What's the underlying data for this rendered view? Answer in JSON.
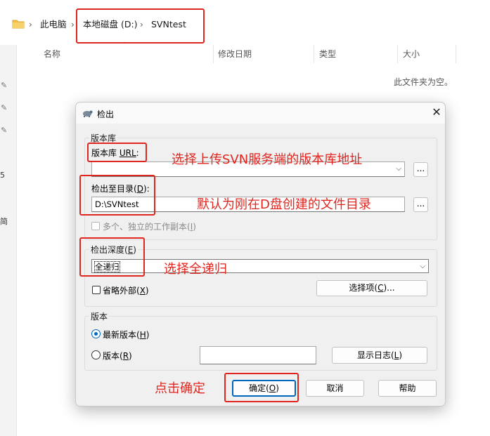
{
  "explorer": {
    "breadcrumb": [
      "此电脑",
      "本地磁盘 (D:)",
      "SVNtest"
    ],
    "columns": [
      "名称",
      "修改日期",
      "类型",
      "大小"
    ],
    "empty_message": "此文件夹为空。",
    "pane_fragments": [
      "5",
      "简"
    ]
  },
  "dialog": {
    "title": "检出",
    "close": "✕",
    "repo_group": "版本库",
    "url_label_prefix": "版本库 ",
    "url_label_key": "URL",
    "url_label_suffix": ":",
    "url_value": "",
    "browse": "...",
    "checkout_dir_prefix": "检出至目录(",
    "checkout_dir_key": "D",
    "checkout_dir_suffix": "):",
    "checkout_dir_value": "D:\\SVNtest",
    "multi_copy_prefix": "多个、独立的工作副本(",
    "multi_copy_key": "I",
    "multi_copy_suffix": ")",
    "depth_group_prefix": "检出深度(",
    "depth_group_key": "E",
    "depth_group_suffix": ")",
    "depth_value": "全递归",
    "omit_prefix": "省略外部(",
    "omit_key": "X",
    "omit_suffix": ")",
    "items_prefix": "选择项(",
    "items_key": "C",
    "items_suffix": ")...",
    "revision_group": "版本",
    "head_prefix": "最新版本(",
    "head_key": "H",
    "head_suffix": ")",
    "rev_prefix": "版本(",
    "rev_key": "R",
    "rev_suffix": ")",
    "rev_value": "",
    "showlog_prefix": "显示日志(",
    "showlog_key": "L",
    "showlog_suffix": ")",
    "ok_prefix": "确定(",
    "ok_key": "O",
    "ok_suffix": ")",
    "cancel": "取消",
    "help": "帮助"
  },
  "annotations": {
    "url": "选择上传SVN服务端的版本库地址",
    "dir": "默认为刚在D盘创建的文件目录",
    "depth": "选择全递归",
    "ok": "点击确定"
  },
  "colors": {
    "annotation": "#e0261f",
    "accent": "#0067c0",
    "folder": "#f2c14e"
  }
}
